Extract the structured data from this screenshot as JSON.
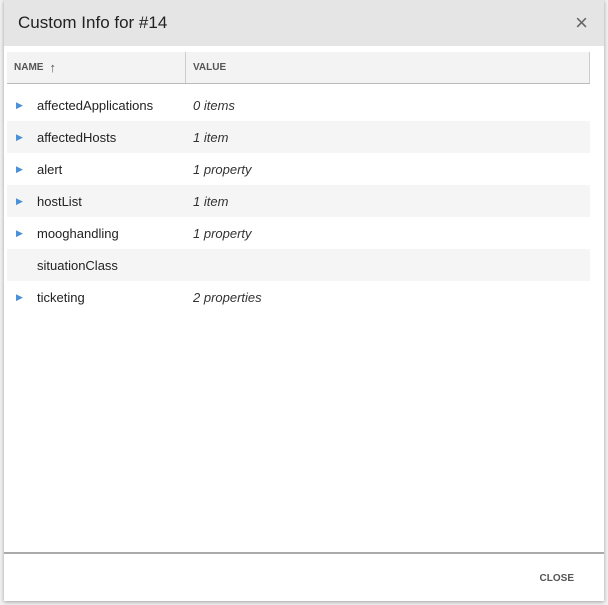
{
  "dialog": {
    "title": "Custom Info for #14",
    "close_label": "CLOSE",
    "close_icon": "×"
  },
  "table": {
    "headers": {
      "name": "NAME",
      "value": "VALUE",
      "sort_icon": "↑"
    },
    "rows": [
      {
        "name": "affectedApplications",
        "value": "0 items",
        "expandable": true
      },
      {
        "name": "affectedHosts",
        "value": "1 item",
        "expandable": true
      },
      {
        "name": "alert",
        "value": "1 property",
        "expandable": true
      },
      {
        "name": "hostList",
        "value": "1 item",
        "expandable": true
      },
      {
        "name": "mooghandling",
        "value": "1 property",
        "expandable": true
      },
      {
        "name": "situationClass",
        "value": "",
        "expandable": false
      },
      {
        "name": "ticketing",
        "value": "2 properties",
        "expandable": true
      }
    ]
  }
}
